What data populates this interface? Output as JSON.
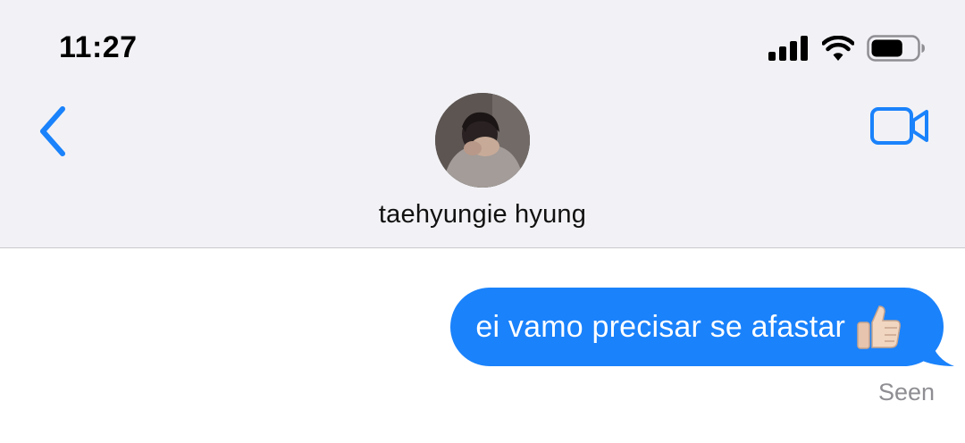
{
  "status_bar": {
    "time": "11:27",
    "signal_icon": "cellular-signal-icon",
    "wifi_icon": "wifi-icon",
    "battery_icon": "battery-icon",
    "battery_level": 0.7
  },
  "header": {
    "back_icon": "chevron-left-icon",
    "video_icon": "video-camera-icon",
    "contact_name": "taehyungie hyung",
    "accent_color": "#1a82fb"
  },
  "messages": [
    {
      "direction": "outgoing",
      "text": "ei vamo precisar se afastar",
      "emoji": "👍🏻",
      "bubble_color": "#1a82fb"
    }
  ],
  "receipt": {
    "status": "Seen"
  }
}
